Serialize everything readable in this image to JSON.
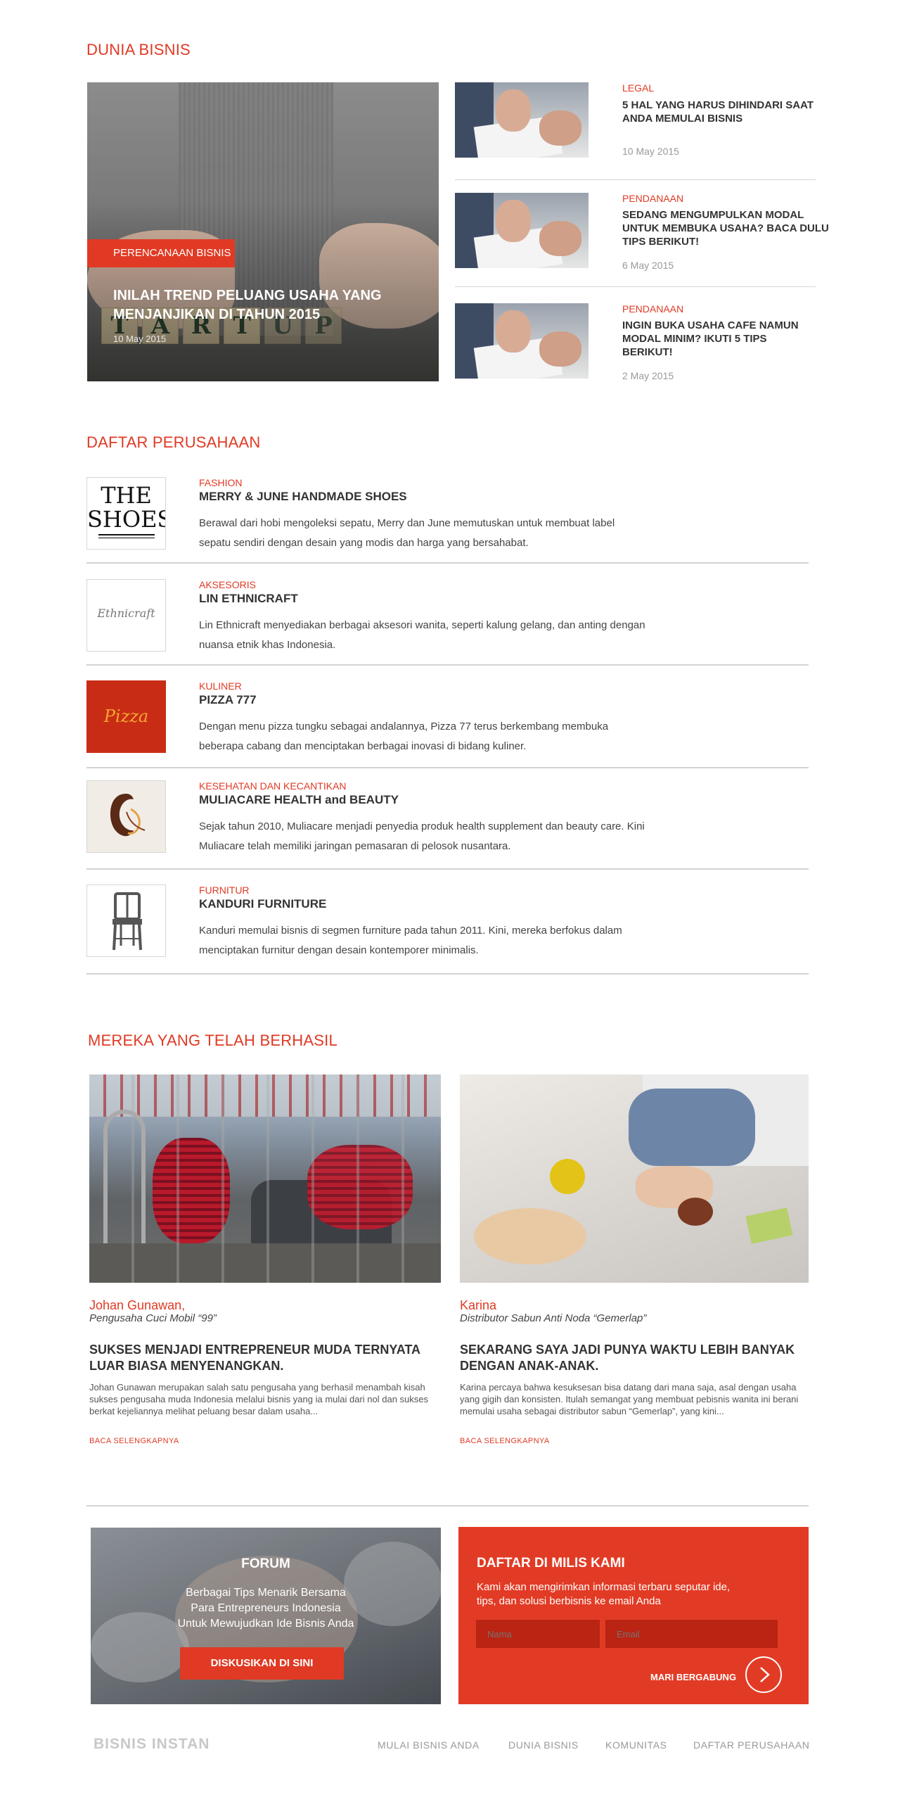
{
  "dunia_bisnis": {
    "title": "DUNIA BISNIS",
    "feature": {
      "badge": "PERENCANAAN BISNIS",
      "title": "INILAH TREND PELUANG USAHA YANG MENJANJIKAN DI TAHUN 2015",
      "date": "10 May 2015",
      "blocks": [
        "T",
        "A",
        "R",
        "T",
        "U",
        "P"
      ]
    },
    "articles": [
      {
        "category": "LEGAL",
        "title": "5 HAL YANG HARUS DIHINDARI SAAT ANDA MEMULAI BISNIS",
        "date": "10 May 2015"
      },
      {
        "category": "PENDANAAN",
        "title": "SEDANG MENGUMPULKAN MODAL UNTUK MEMBUKA USAHA? BACA DULU TIPS BERIKUT!",
        "date": "6 May 2015"
      },
      {
        "category": "PENDANAAN",
        "title": "INGIN BUKA USAHA CAFE NAMUN MODAL MINIM? IKUTI 5 TIPS BERIKUT!",
        "date": "2 May 2015"
      }
    ]
  },
  "daftar_perusahaan": {
    "title": "DAFTAR PERUSAHAAN",
    "companies": [
      {
        "category": "FASHION",
        "name": "MERRY & JUNE HANDMADE SHOES",
        "desc_1": "Berawal dari hobi mengoleksi sepatu, Merry dan June memutuskan untuk membuat label",
        "desc_2": "sepatu sendiri dengan desain yang modis dan harga yang bersahabat.",
        "logo_text_1": "THE",
        "logo_text_2": "SHOES"
      },
      {
        "category": "AKSESORIS",
        "name": "LIN ETHNICRAFT",
        "desc_1": "Lin Ethnicraft menyediakan berbagai aksesori wanita, seperti kalung gelang, dan anting dengan",
        "desc_2": "nuansa etnik khas Indonesia.",
        "logo_text_1": "Ethnicraft"
      },
      {
        "category": "KULINER",
        "name": "PIZZA 777",
        "desc_1": "Dengan menu pizza tungku sebagai andalannya, Pizza 77 terus berkembang membuka",
        "desc_2": "beberapa cabang dan menciptakan berbagai inovasi di bidang kuliner.",
        "logo_text_1": "Pizza"
      },
      {
        "category": "KESEHATAN DAN KECANTIKAN",
        "name": "MULIACARE HEALTH and BEAUTY",
        "desc_1": "Sejak tahun 2010, Muliacare menjadi penyedia produk health supplement dan beauty care. Kini",
        "desc_2": "Muliacare telah memiliki jaringan pemasaran di pelosok nusantara."
      },
      {
        "category": "FURNITUR",
        "name": "KANDURI FURNITURE",
        "desc_1": "Kanduri memulai bisnis di segmen furniture pada tahun 2011. Kini, mereka berfokus dalam",
        "desc_2": "menciptakan furnitur dengan desain kontemporer minimalis."
      }
    ]
  },
  "mereka": {
    "title": "MEREKA YANG TELAH BERHASIL",
    "stories": [
      {
        "name": "Johan Gunawan,",
        "role": "Pengusaha Cuci Mobil “99”",
        "headline": "SUKSES MENJADI ENTREPRENEUR MUDA TERNYATA LUAR BIASA MENYENANGKAN.",
        "body": "Johan Gunawan merupakan salah satu pengusaha yang berhasil menambah kisah sukses pengusaha muda Indonesia melalui bisnis yang ia mulai dari nol dan sukses berkat kejeliannya melihat peluang besar dalam usaha...",
        "more": "BACA SELENGKAPNYA"
      },
      {
        "name": "Karina",
        "role": "Distributor Sabun Anti Noda “Gemerlap”",
        "headline": "SEKARANG SAYA JADI PUNYA WAKTU LEBIH BANYAK DENGAN ANAK-ANAK.",
        "body": "Karina percaya bahwa kesuksesan bisa datang dari mana saja, asal dengan usaha yang gigih dan konsisten. Itulah semangat yang membuat pebisnis wanita ini berani memulai usaha sebagai distributor sabun “Gemerlap”, yang kini...",
        "more": "BACA SELENGKAPNYA"
      }
    ]
  },
  "forum": {
    "title": "FORUM",
    "line_1": "Berbagai Tips Menarik Bersama",
    "line_2": "Para Entrepreneurs Indonesia",
    "line_3": "Untuk Mewujudkan Ide Bisnis Anda",
    "button": "DISKUSIKAN DI SINI"
  },
  "mailing": {
    "title": "DAFTAR DI MILIS KAMI",
    "desc_1": "Kami akan mengirimkan informasi terbaru seputar ide,",
    "desc_2": "tips, dan solusi berbisnis ke email Anda",
    "name_placeholder": "Nama",
    "email_placeholder": "Email",
    "join": "MARI BERGABUNG"
  },
  "footer": {
    "logo": "BISNIS INSTAN",
    "nav": [
      "MULAI BISNIS ANDA",
      "DUNIA BISNIS",
      "KOMUNITAS",
      "DAFTAR PERUSAHAAN"
    ]
  },
  "colors": {
    "accent": "#e03a24",
    "text": "#333333",
    "muted": "#999999"
  }
}
